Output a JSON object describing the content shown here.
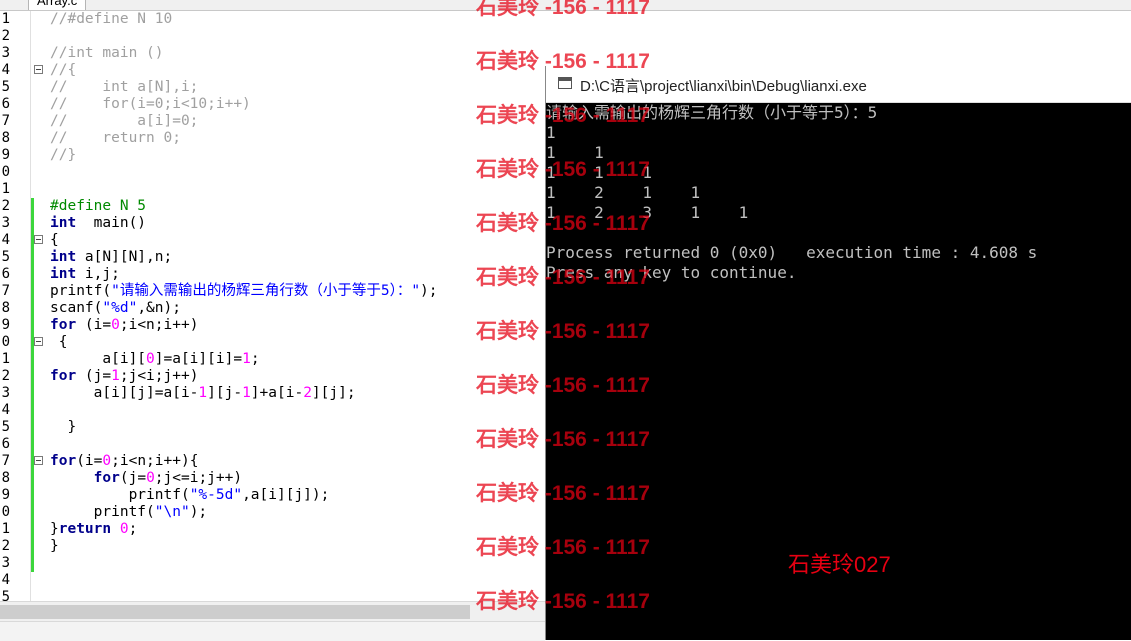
{
  "editor": {
    "tab_label": "Array.c",
    "lines": [
      {
        "n": "1",
        "fold": false,
        "segs": [
          [
            "cm",
            "//#define N 10"
          ]
        ]
      },
      {
        "n": "2",
        "fold": false,
        "segs": []
      },
      {
        "n": "3",
        "fold": false,
        "segs": [
          [
            "cm",
            "//int main ()"
          ]
        ]
      },
      {
        "n": "4",
        "fold": true,
        "segs": [
          [
            "cm",
            "//{"
          ]
        ]
      },
      {
        "n": "5",
        "fold": false,
        "segs": [
          [
            "cm",
            "//    int a[N],i;"
          ]
        ]
      },
      {
        "n": "6",
        "fold": false,
        "segs": [
          [
            "cm",
            "//    for(i=0;i<10;i++)"
          ]
        ]
      },
      {
        "n": "7",
        "fold": false,
        "segs": [
          [
            "cm",
            "//        a[i]=0;"
          ]
        ]
      },
      {
        "n": "8",
        "fold": false,
        "segs": [
          [
            "cm",
            "//    return 0;"
          ]
        ]
      },
      {
        "n": "9",
        "fold": false,
        "segs": [
          [
            "cm",
            "//}"
          ]
        ]
      },
      {
        "n": "0",
        "fold": false,
        "segs": []
      },
      {
        "n": "1",
        "fold": false,
        "segs": []
      },
      {
        "n": "2",
        "fold": false,
        "segs": [
          [
            "pp",
            "#define N 5"
          ]
        ]
      },
      {
        "n": "3",
        "fold": false,
        "segs": [
          [
            "kw",
            "int"
          ],
          [
            "",
            "  main()"
          ]
        ]
      },
      {
        "n": "4",
        "fold": true,
        "segs": [
          [
            "",
            "{"
          ]
        ]
      },
      {
        "n": "5",
        "fold": false,
        "segs": [
          [
            "kw",
            "int"
          ],
          [
            "",
            " a[N][N],n;"
          ]
        ]
      },
      {
        "n": "6",
        "fold": false,
        "segs": [
          [
            "kw",
            "int"
          ],
          [
            "",
            " i,j;"
          ]
        ]
      },
      {
        "n": "7",
        "fold": false,
        "segs": [
          [
            "",
            "printf("
          ],
          [
            "st",
            "\"请输入需输出的杨辉三角行数（小于等于5）：\""
          ],
          [
            "",
            ");"
          ]
        ]
      },
      {
        "n": "8",
        "fold": false,
        "segs": [
          [
            "",
            "scanf("
          ],
          [
            "st",
            "\"%d\""
          ],
          [
            "",
            ",&n);"
          ]
        ]
      },
      {
        "n": "9",
        "fold": false,
        "segs": [
          [
            "kw",
            "for"
          ],
          [
            "",
            " (i="
          ],
          [
            "nm",
            "0"
          ],
          [
            "",
            ";i<n;i++)"
          ]
        ]
      },
      {
        "n": "0",
        "fold": true,
        "segs": [
          [
            "",
            " {"
          ]
        ]
      },
      {
        "n": "1",
        "fold": false,
        "segs": [
          [
            "",
            "      a[i]["
          ],
          [
            "nm",
            "0"
          ],
          [
            "",
            "]=a[i][i]="
          ],
          [
            "nm",
            "1"
          ],
          [
            "",
            ";"
          ]
        ]
      },
      {
        "n": "2",
        "fold": false,
        "segs": [
          [
            "kw",
            "for"
          ],
          [
            "",
            " (j="
          ],
          [
            "nm",
            "1"
          ],
          [
            "",
            ";j<i;j++)"
          ]
        ]
      },
      {
        "n": "3",
        "fold": false,
        "segs": [
          [
            "",
            "     a[i][j]=a[i-"
          ],
          [
            "nm",
            "1"
          ],
          [
            "",
            "][j-"
          ],
          [
            "nm",
            "1"
          ],
          [
            "",
            "]+a[i-"
          ],
          [
            "nm",
            "2"
          ],
          [
            "",
            "][j];"
          ]
        ]
      },
      {
        "n": "4",
        "fold": false,
        "segs": []
      },
      {
        "n": "5",
        "fold": false,
        "segs": [
          [
            "",
            "  }"
          ]
        ]
      },
      {
        "n": "6",
        "fold": false,
        "segs": []
      },
      {
        "n": "7",
        "fold": true,
        "segs": [
          [
            "kw",
            "for"
          ],
          [
            "",
            "(i="
          ],
          [
            "nm",
            "0"
          ],
          [
            "",
            ";i<n;i++){"
          ]
        ]
      },
      {
        "n": "8",
        "fold": false,
        "segs": [
          [
            "",
            "     "
          ],
          [
            "kw",
            "for"
          ],
          [
            "",
            "(j="
          ],
          [
            "nm",
            "0"
          ],
          [
            "",
            ";j<=i;j++)"
          ]
        ]
      },
      {
        "n": "9",
        "fold": false,
        "segs": [
          [
            "",
            "         printf("
          ],
          [
            "st",
            "\"%-5d\""
          ],
          [
            "",
            ",a[i][j]);"
          ]
        ]
      },
      {
        "n": "0",
        "fold": false,
        "segs": [
          [
            "",
            "     printf("
          ],
          [
            "st",
            "\"\\n\""
          ],
          [
            "",
            ");"
          ]
        ]
      },
      {
        "n": "1",
        "fold": false,
        "segs": [
          [
            "",
            "}"
          ],
          [
            "kw",
            "return"
          ],
          [
            "",
            " "
          ],
          [
            "nm",
            "0"
          ],
          [
            "",
            ";"
          ]
        ]
      },
      {
        "n": "2",
        "fold": false,
        "segs": [
          [
            "",
            "}"
          ]
        ]
      },
      {
        "n": "3",
        "fold": false,
        "segs": []
      },
      {
        "n": "4",
        "fold": false,
        "segs": []
      },
      {
        "n": "5",
        "fold": false,
        "segs": []
      }
    ]
  },
  "console": {
    "title": "D:\\C语言\\project\\lianxi\\bin\\Debug\\lianxi.exe",
    "lines": [
      "请输入需输出的杨辉三角行数（小于等于5）：5",
      "1",
      "1    1",
      "1    1    1",
      "1    2    1    1",
      "1    2    3    1    1",
      "",
      "Process returned 0 (0x0)   execution time : 4.608 s",
      "Press any key to continue."
    ]
  },
  "watermark": {
    "repeat_text": "石美玲 -156 - 1117",
    "center_text": "石美玲027"
  },
  "colors": {
    "comment": "#a0a0a0",
    "keyword": "#00008b",
    "preprocessor": "#008a00",
    "string": "#0000ff",
    "number": "#ff00ff",
    "watermark": "#e60012",
    "console_bg": "#000000",
    "console_text": "#c0c0c0"
  }
}
